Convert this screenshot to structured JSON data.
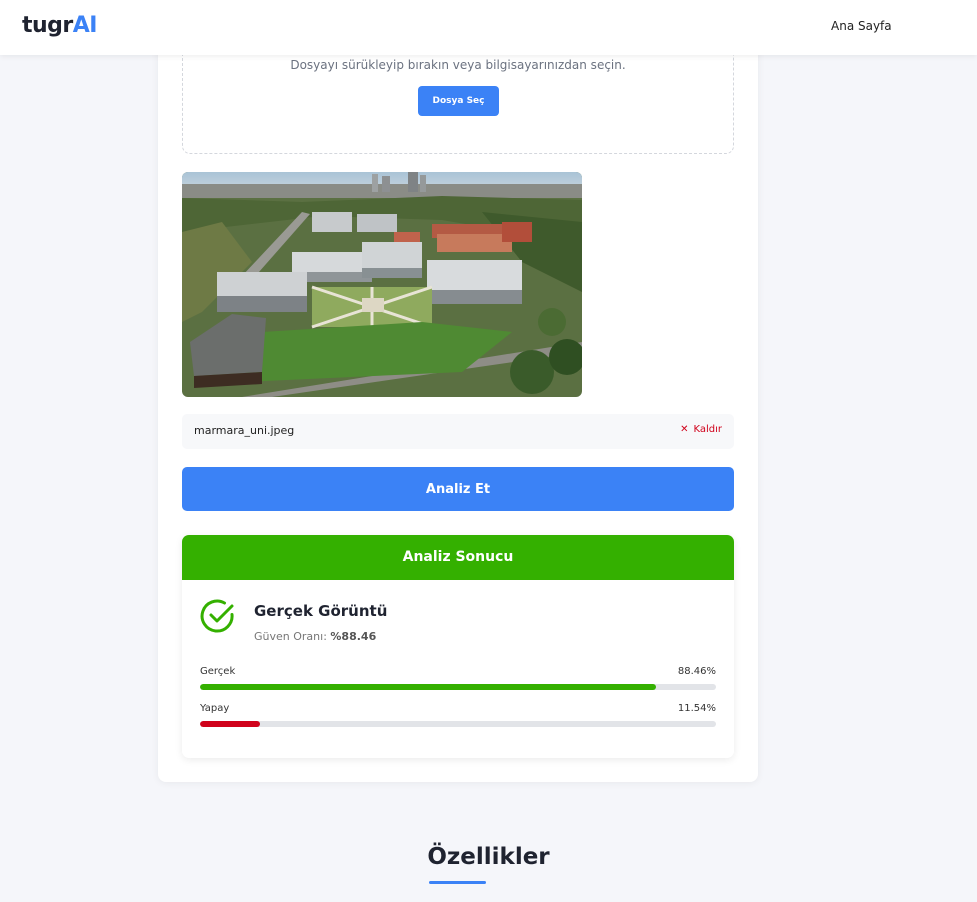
{
  "header": {
    "logo_main": "tugr",
    "logo_accent": "AI",
    "nav_home": "Ana Sayfa"
  },
  "upload": {
    "instructions": "Dosyayı sürükleyip bırakın veya bilgisayarınızdan seçin.",
    "choose_button": "Dosya Seç"
  },
  "file": {
    "name": "marmara_uni.jpeg",
    "remove_label": "Kaldır",
    "remove_icon": "close-icon"
  },
  "analyze_button": "Analiz Et",
  "result": {
    "title": "Analiz Sonucu",
    "verdict": "Gerçek Görüntü",
    "confidence_label": "Güven Oranı:",
    "confidence_value": "%88.46",
    "bars": [
      {
        "label": "Gerçek",
        "value": 88.46,
        "display": "88.46%",
        "color": "#34b000"
      },
      {
        "label": "Yapay",
        "value": 11.54,
        "display": "11.54%",
        "color": "#d0021b"
      }
    ]
  },
  "features": {
    "title": "Özellikler"
  },
  "colors": {
    "primary": "#3b82f6",
    "success": "#34b000",
    "danger": "#d0021b"
  }
}
